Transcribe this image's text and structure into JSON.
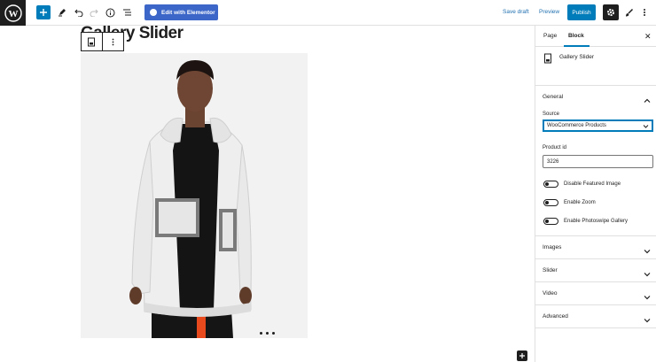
{
  "toolbar": {
    "elementor_label": "Edit with Elementor",
    "save_draft": "Save draft",
    "preview": "Preview",
    "publish": "Publish"
  },
  "editor": {
    "title": "Gallery Slider"
  },
  "sidebar": {
    "tabs": [
      "Page",
      "Block"
    ],
    "active_tab": "Block",
    "block_name": "Gallery Slider",
    "general": {
      "title": "General",
      "source_label": "Source",
      "source_value": "WooCommerce Products",
      "product_id_label": "Product id",
      "product_id_value": "3226",
      "toggles": [
        "Disable Featured Image",
        "Enable Zoom",
        "Enable Photoswipe Gallery"
      ]
    },
    "panels": [
      "Images",
      "Slider",
      "Video",
      "Advanced"
    ]
  },
  "colors": {
    "accent": "#007cba",
    "elementor": "#3c67c9",
    "dark": "#1e1e1e"
  }
}
